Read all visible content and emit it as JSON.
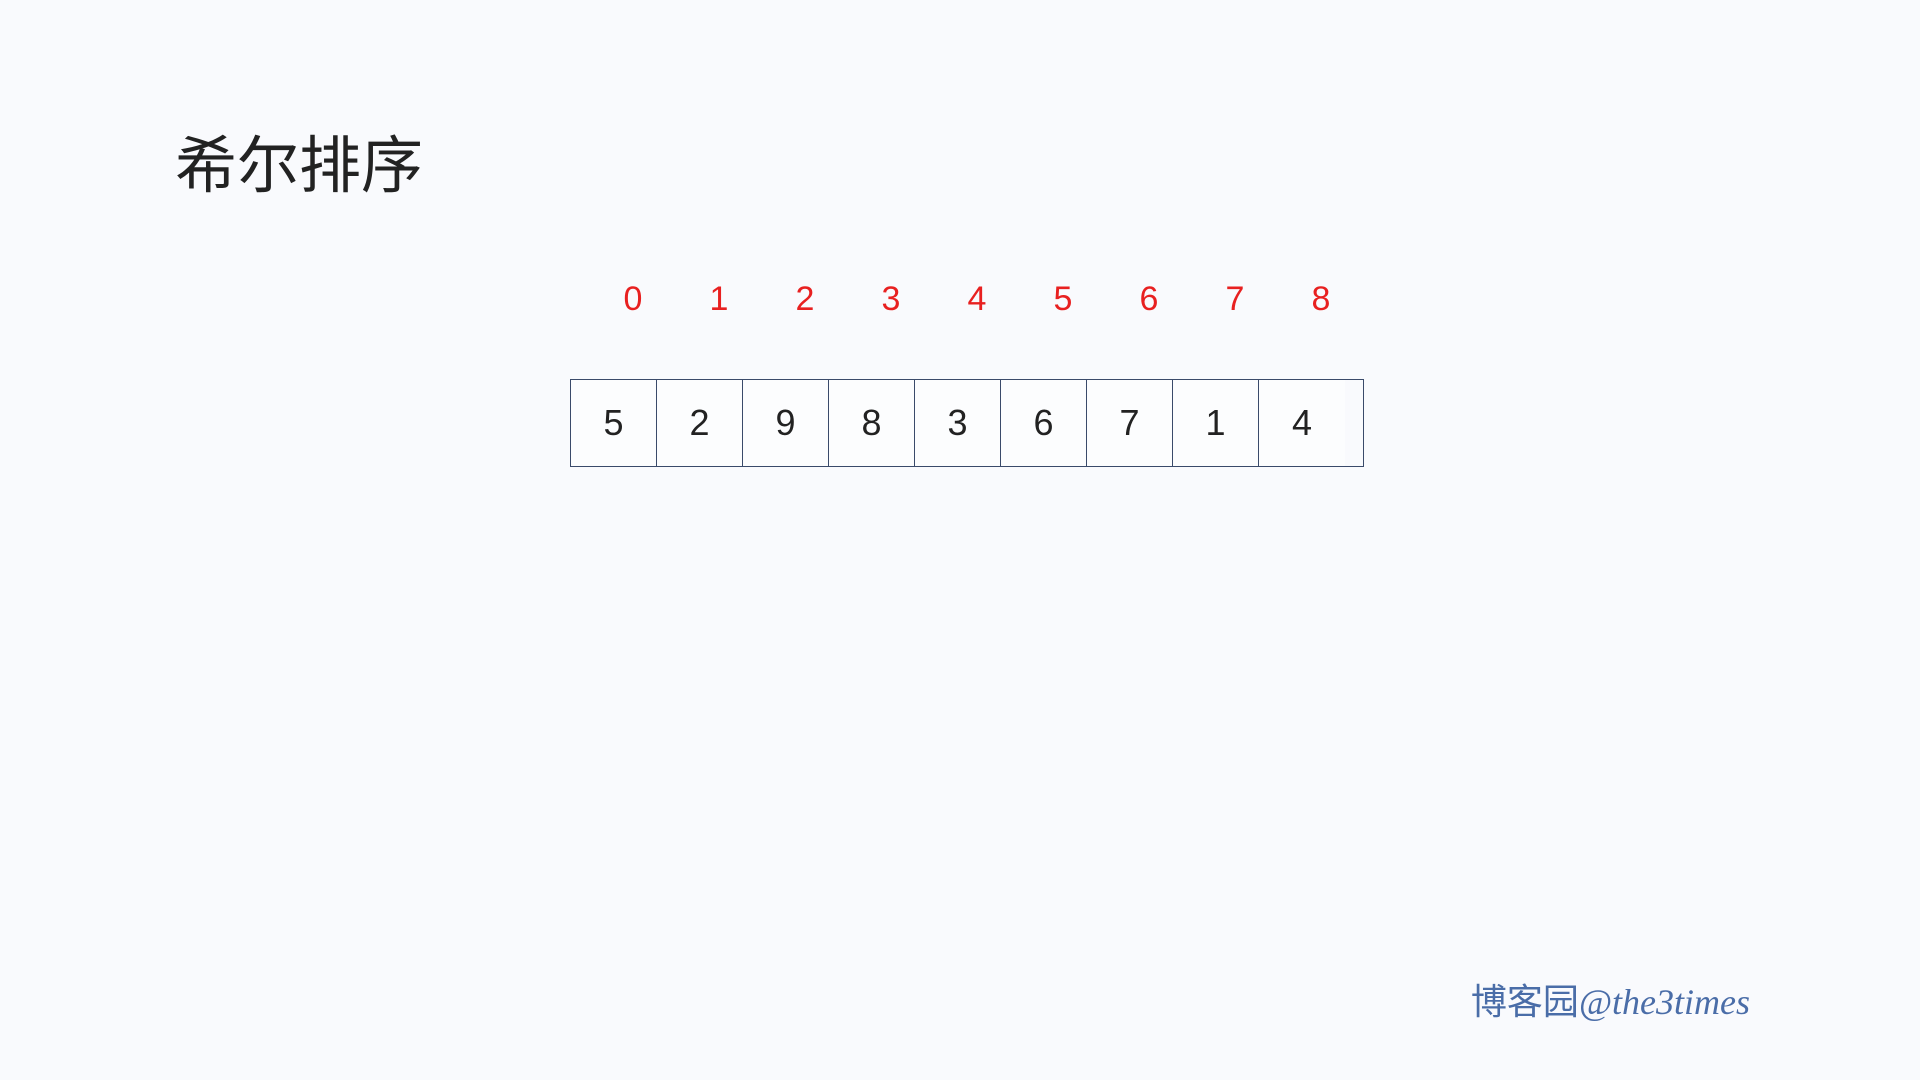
{
  "title": "希尔排序",
  "indices": [
    "0",
    "1",
    "2",
    "3",
    "4",
    "5",
    "6",
    "7",
    "8"
  ],
  "values": [
    "5",
    "2",
    "9",
    "8",
    "3",
    "6",
    "7",
    "1",
    "4"
  ],
  "credit": {
    "site": "博客园",
    "handle": "@the3times"
  }
}
